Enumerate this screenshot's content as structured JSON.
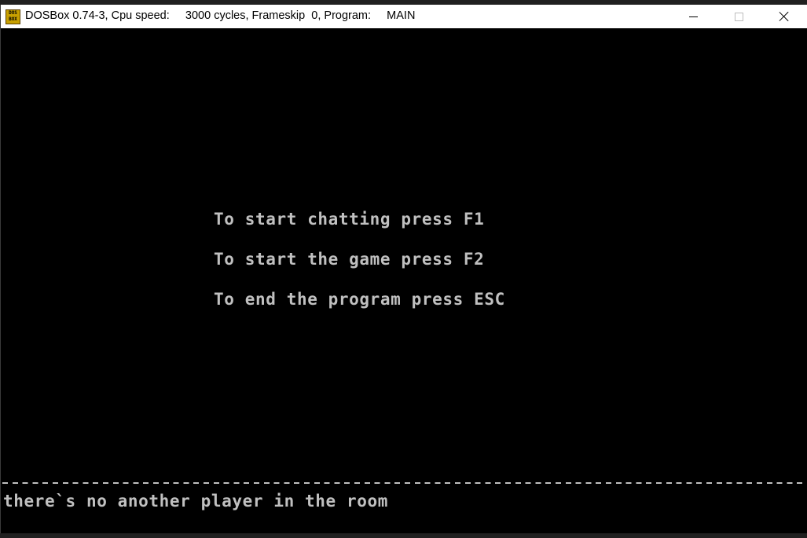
{
  "window": {
    "title": "DOSBox 0.74-3, Cpu speed:     3000 cycles, Frameskip  0, Program:     MAIN",
    "icon_text_top": "DOS",
    "icon_text_bottom": "BOX",
    "icon_name": "dosbox-icon"
  },
  "controls": {
    "minimize_icon": "minimize-icon",
    "maximize_icon": "maximize-icon",
    "close_icon": "close-icon"
  },
  "screen": {
    "menu": [
      "To start chatting press F1",
      "To start the game press F2",
      "To end the program press ESC"
    ],
    "divider_char": "-",
    "status": "there`s no another player in the room"
  },
  "colors": {
    "screen_bg": "#000000",
    "text": "#c0c0c0",
    "titlebar_bg": "#ffffff"
  }
}
